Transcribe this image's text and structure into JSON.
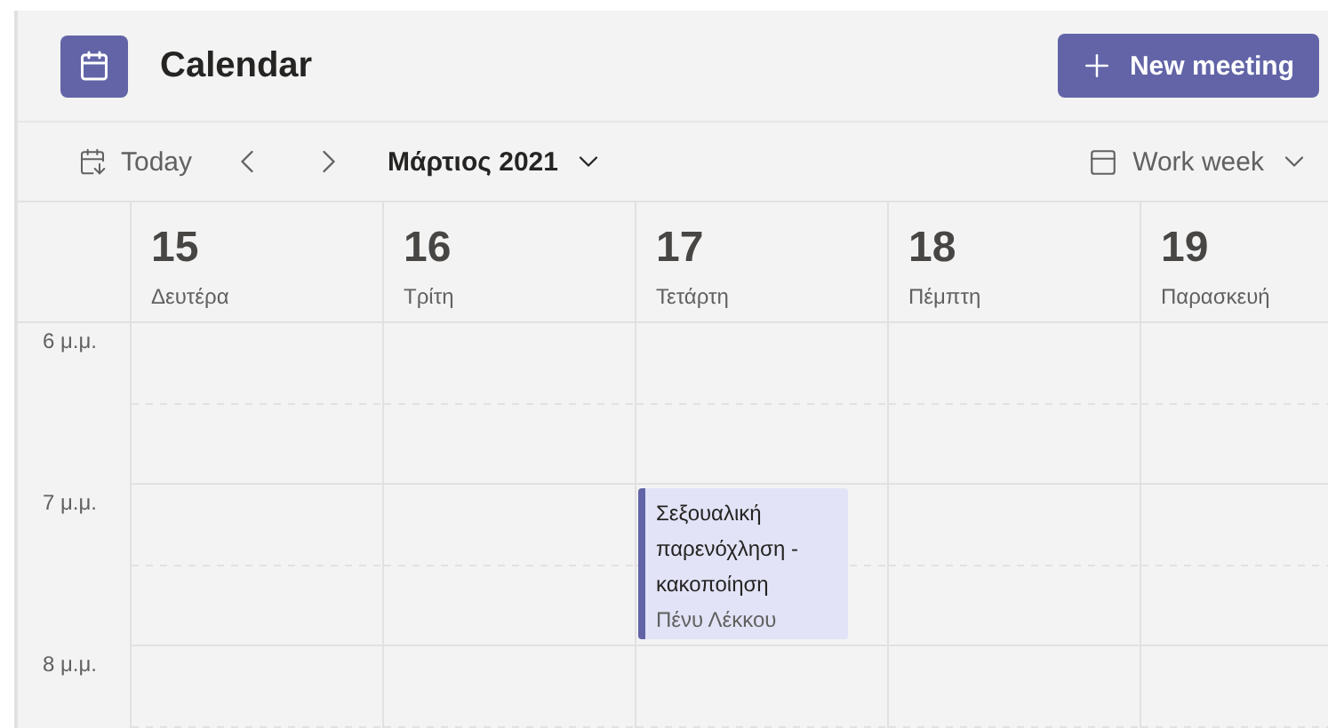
{
  "header": {
    "title": "Calendar",
    "new_meeting": "New meeting"
  },
  "toolbar": {
    "today": "Today",
    "month": "Μάρτιος 2021",
    "view": "Work week"
  },
  "days": [
    {
      "number": "15",
      "name": "Δευτέρα"
    },
    {
      "number": "16",
      "name": "Τρίτη"
    },
    {
      "number": "17",
      "name": "Τετάρτη"
    },
    {
      "number": "18",
      "name": "Πέμπτη"
    },
    {
      "number": "19",
      "name": "Παρασκευή"
    }
  ],
  "rows": [
    {
      "time": "6 μ.μ.",
      "cells": [
        {
          "kind": "empty"
        },
        {
          "kind": "empty"
        },
        {
          "kind": "empty"
        },
        {
          "kind": "empty"
        },
        {
          "kind": "empty"
        }
      ]
    },
    {
      "time": "7 μ.μ.",
      "cells": [
        {
          "kind": "empty"
        },
        {
          "kind": "empty"
        },
        {
          "kind": "event",
          "title": "Σεξουαλική παρενόχληση - κακοποίηση",
          "organizer": "Πένυ Λέκκου"
        },
        {
          "kind": "empty"
        },
        {
          "kind": "empty"
        }
      ]
    },
    {
      "time": "8 μ.μ.",
      "cells": [
        {
          "kind": "empty"
        },
        {
          "kind": "empty"
        },
        {
          "kind": "empty"
        },
        {
          "kind": "empty"
        },
        {
          "kind": "empty"
        }
      ]
    }
  ]
}
